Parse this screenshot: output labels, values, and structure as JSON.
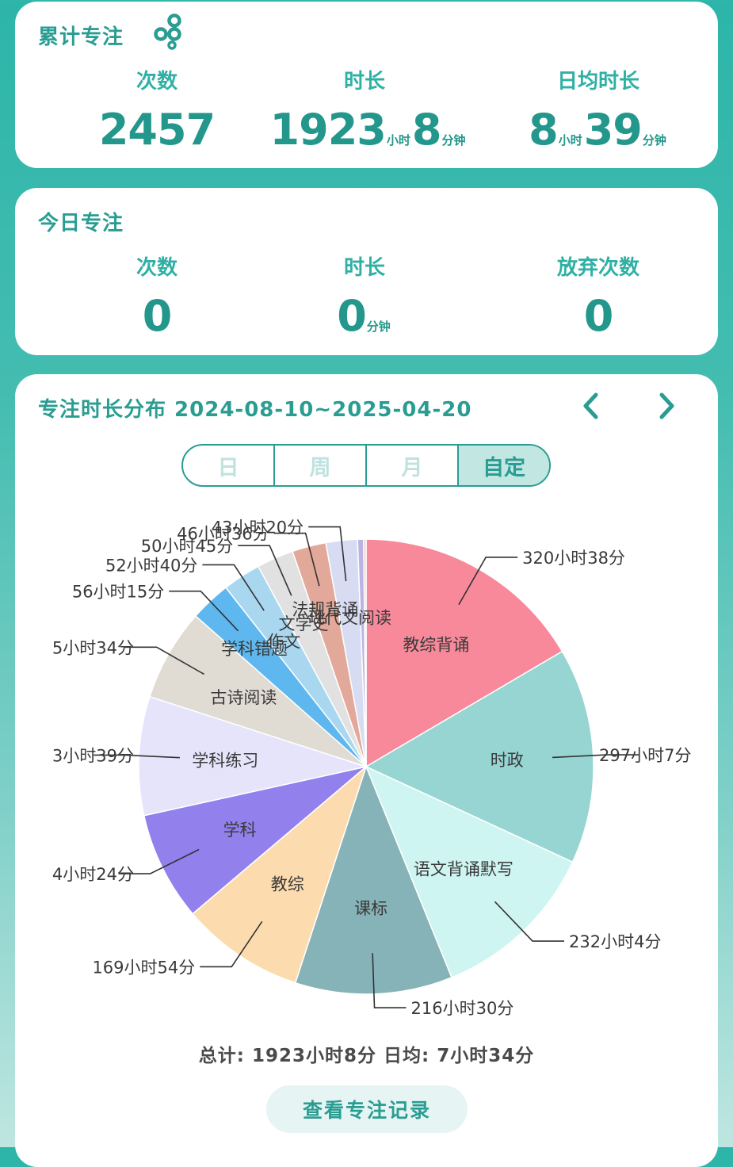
{
  "total": {
    "title": "累计专注",
    "count_label": "次数",
    "count_value": "2457",
    "duration_label": "时长",
    "duration_hours": "1923",
    "duration_hours_unit": "小时",
    "duration_minutes": "8",
    "duration_minutes_unit": "分钟",
    "daily_label": "日均时长",
    "daily_hours": "8",
    "daily_hours_unit": "小时",
    "daily_minutes": "39",
    "daily_minutes_unit": "分钟"
  },
  "today": {
    "title": "今日专注",
    "count_label": "次数",
    "count_value": "0",
    "duration_label": "时长",
    "duration_minutes": "0",
    "duration_minutes_unit": "分钟",
    "abandon_label": "放弃次数",
    "abandon_value": "0"
  },
  "distribution": {
    "title": "专注时长分布 2024-08-10~2025-04-20",
    "segments": [
      "日",
      "周",
      "月",
      "自定"
    ],
    "active_segment": "自定",
    "summary": "总计: 1923小时8分  日均: 7小时34分",
    "records_button": "查看专注记录"
  },
  "chart_data": {
    "type": "pie",
    "slices": [
      {
        "category": "教综背诵",
        "value_label": "320小时38分",
        "minutes": 19238,
        "color": "#f7899b"
      },
      {
        "category": "时政",
        "value_label": "297小时7分",
        "minutes": 17827,
        "color": "#96d5d2"
      },
      {
        "category": "语文背诵默写",
        "value_label": "232小时4分",
        "minutes": 13924,
        "color": "#cff5f3"
      },
      {
        "category": "课标",
        "value_label": "216小时30分",
        "minutes": 12990,
        "color": "#86b3b7"
      },
      {
        "category": "教综",
        "value_label": "169小时54分",
        "minutes": 10194,
        "color": "#fcdcaf"
      },
      {
        "category": "学科",
        "value_label": "4小时24分",
        "minutes": 9000,
        "color": "#9281ec"
      },
      {
        "category": "学科练习",
        "value_label": "3小时39分",
        "minutes": 9800,
        "color": "#e6e4fb"
      },
      {
        "category": "古诗阅读",
        "value_label": "5小时34分",
        "minutes": 7600,
        "color": "#e0dbd3"
      },
      {
        "category": "学科错题",
        "value_label": "56小时15分",
        "minutes": 3375,
        "color": "#5eb7ee"
      },
      {
        "category": "作文",
        "value_label": "52小时40分",
        "minutes": 3160,
        "color": "#a9d7ef"
      },
      {
        "category": "文学史",
        "value_label": "50小时45分",
        "minutes": 3045,
        "color": "#e1e1e1"
      },
      {
        "category": "法规背诵",
        "value_label": "46小时36分",
        "minutes": 2796,
        "color": "#e2a899"
      },
      {
        "category": "现代文阅读",
        "value_label": "43小时20分",
        "minutes": 2600,
        "color": "#d8dcf3"
      },
      {
        "category": "",
        "value_label": "",
        "minutes": 500,
        "color": "#b9b5e2"
      },
      {
        "category": "",
        "value_label": "",
        "minutes": 200,
        "color": "#f4c3c8"
      }
    ]
  },
  "icons": {
    "rings": "rings-icon",
    "prev": "chevron-left-icon",
    "next": "chevron-right-icon"
  },
  "colors": {
    "accent": "#2a9d92",
    "background": "#2db5a9"
  }
}
